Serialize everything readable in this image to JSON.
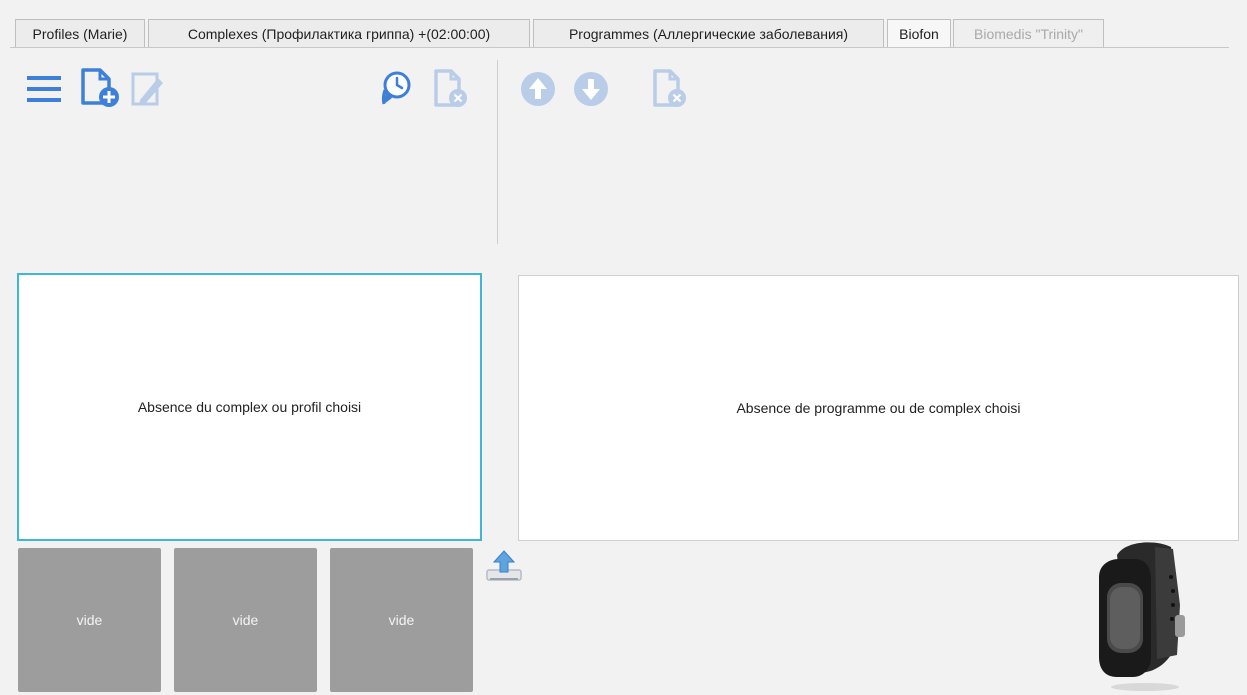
{
  "tabs": [
    {
      "label": "Profiles (Marie)"
    },
    {
      "label": "Complexes (Профилактика гриппа) +(02:00:00)"
    },
    {
      "label": "Programmes (Аллергические заболевания)"
    },
    {
      "label": "Biofon"
    },
    {
      "label": "Biomedis \"Trinity\""
    }
  ],
  "left_panel": {
    "empty_text": "Absence du complex ou profil choisi"
  },
  "right_panel": {
    "empty_text": "Absence de programme ou de complex choisi"
  },
  "slots": [
    {
      "label": "vide"
    },
    {
      "label": "vide"
    },
    {
      "label": "vide"
    }
  ],
  "colors": {
    "accent_blue": "#3d7fd9",
    "disabled_blue": "#b9cce8",
    "panel_focus_border": "#3fb6d6",
    "slot_gray": "#9d9d9d"
  },
  "icons": [
    "menu-icon",
    "add-file-icon",
    "edit-icon",
    "timer-icon",
    "delete-file-icon",
    "arrow-up-icon",
    "arrow-down-icon",
    "delete-file-icon",
    "upload-icon",
    "device-bracelet-icon"
  ]
}
